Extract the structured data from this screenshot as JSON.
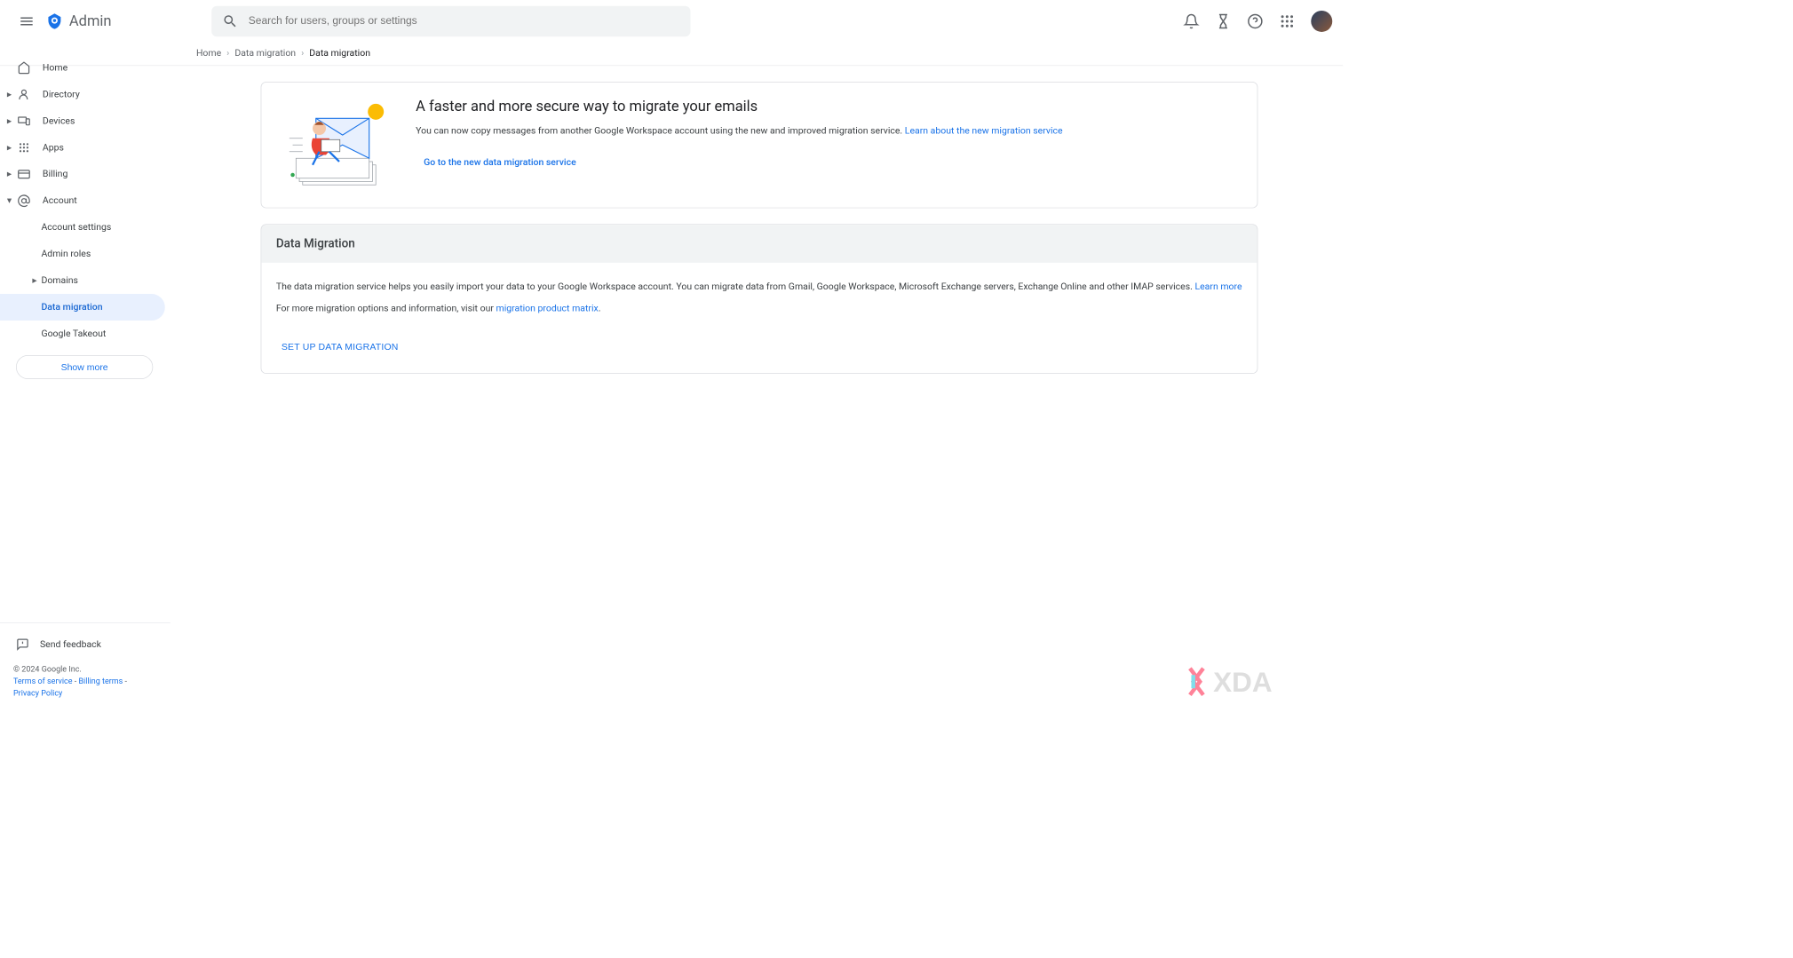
{
  "header": {
    "product_name": "Admin",
    "search_placeholder": "Search for users, groups or settings"
  },
  "breadcrumb": {
    "items": [
      "Home",
      "Data migration",
      "Data migration"
    ]
  },
  "sidebar": {
    "items": [
      {
        "label": "Home",
        "icon": "home"
      },
      {
        "label": "Directory",
        "icon": "person",
        "expandable": true
      },
      {
        "label": "Devices",
        "icon": "devices",
        "expandable": true
      },
      {
        "label": "Apps",
        "icon": "apps",
        "expandable": true
      },
      {
        "label": "Billing",
        "icon": "credit_card",
        "expandable": true
      },
      {
        "label": "Account",
        "icon": "alternate_email",
        "expandable": true,
        "expanded": true
      }
    ],
    "account_children": [
      {
        "label": "Account settings"
      },
      {
        "label": "Admin roles"
      },
      {
        "label": "Domains",
        "expandable": true
      },
      {
        "label": "Data migration",
        "active": true
      },
      {
        "label": "Google Takeout"
      }
    ],
    "show_more": "Show more",
    "feedback": "Send feedback"
  },
  "footer": {
    "copyright": "© 2024 Google Inc.",
    "terms": "Terms of service",
    "billing": "Billing terms",
    "privacy": "Privacy Policy",
    "separator": " - "
  },
  "promo": {
    "title": "A faster and more secure way to migrate your emails",
    "text": "You can now copy messages from another Google Workspace account using the new and improved migration service. ",
    "learn_link": "Learn about the new migration service",
    "go_link": "Go to the new data migration service"
  },
  "section": {
    "title": "Data Migration",
    "text1_prefix": "The data migration service helps you easily import your data to your Google Workspace account. You can migrate data from Gmail, Google Workspace, Microsoft Exchange servers, Exchange Online and other IMAP services. ",
    "learn_more": "Learn more",
    "text2_prefix": "For more migration options and information, visit our ",
    "matrix_link": "migration product matrix",
    "text2_suffix": ".",
    "setup_button": "SET UP DATA MIGRATION"
  }
}
